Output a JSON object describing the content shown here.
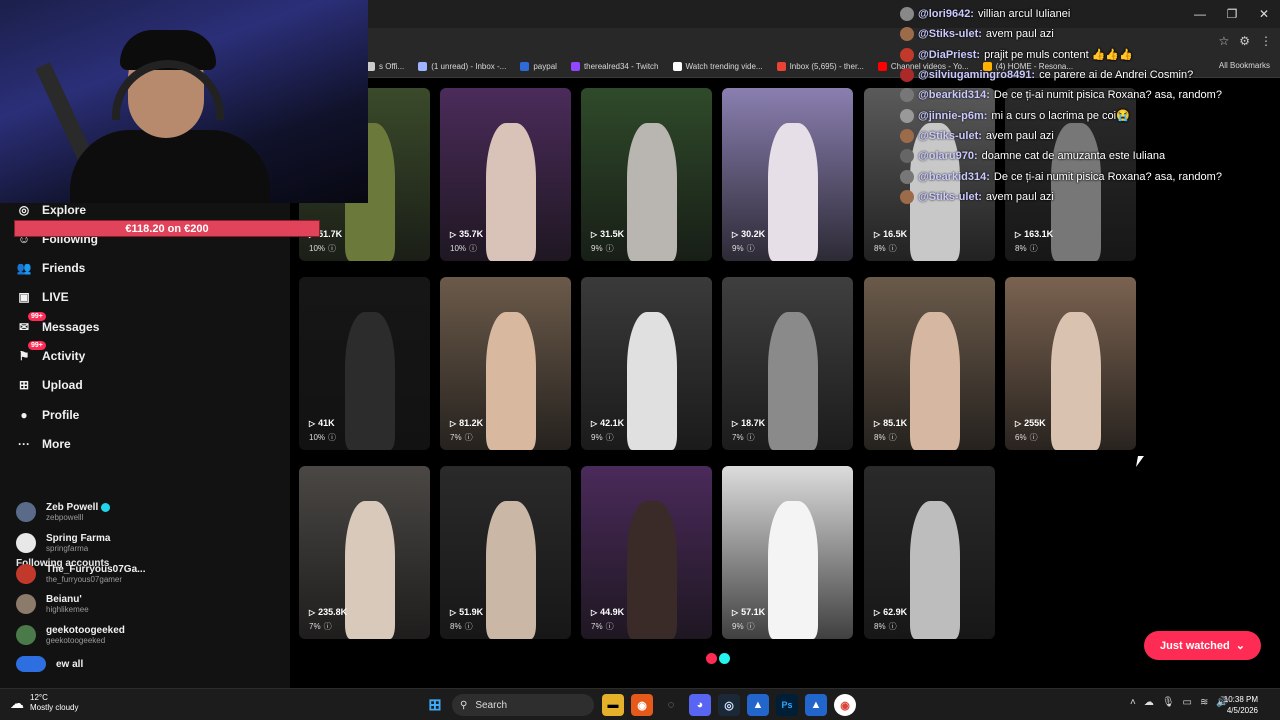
{
  "browser": {
    "bookmarks": [
      {
        "label": "s Offi...",
        "color": "#cccccc"
      },
      {
        "label": "(1 unread) - Inbox -...",
        "color": "#9fb4ff"
      },
      {
        "label": "paypal",
        "color": "#2f6bd8"
      },
      {
        "label": "therealred34 - Twitch",
        "color": "#9146ff"
      },
      {
        "label": "Watch trending vide...",
        "color": "#ffffff"
      },
      {
        "label": "Inbox (5,695) - ther...",
        "color": "#ea4335"
      },
      {
        "label": "Channel videos - Yo...",
        "color": "#ff0000"
      },
      {
        "label": "(4) HOME - Resona...",
        "color": "#ffb300"
      }
    ],
    "all_bookmarks": "All Bookmarks",
    "window_controls": [
      "—",
      "❐",
      "✕"
    ]
  },
  "overlay": {
    "donation": "€118.20 on €200"
  },
  "sidebar": {
    "nav": [
      {
        "label": "Explore",
        "icon": "compass-icon",
        "glyph": "◎",
        "badge": ""
      },
      {
        "label": "Following",
        "icon": "following-icon",
        "glyph": "☺",
        "badge": ""
      },
      {
        "label": "Friends",
        "icon": "friends-icon",
        "glyph": "👥",
        "badge": ""
      },
      {
        "label": "LIVE",
        "icon": "live-icon",
        "glyph": "▣",
        "badge": ""
      },
      {
        "label": "Messages",
        "icon": "messages-icon",
        "glyph": "✉",
        "badge": "99+"
      },
      {
        "label": "Activity",
        "icon": "activity-icon",
        "glyph": "⚑",
        "badge": "99+"
      },
      {
        "label": "Upload",
        "icon": "upload-icon",
        "glyph": "⊞",
        "badge": ""
      },
      {
        "label": "Profile",
        "icon": "profile-icon",
        "glyph": "●",
        "badge": ""
      },
      {
        "label": "More",
        "icon": "more-icon",
        "glyph": "···",
        "badge": ""
      }
    ],
    "following_accounts_title": "Following accounts",
    "accounts": [
      {
        "name": "Zeb Powell",
        "handle": "zebpowelll",
        "verified": true,
        "color": "#5a6b8a"
      },
      {
        "name": "Spring Farma",
        "handle": "springfarma",
        "verified": false,
        "color": "#e8e8e8"
      },
      {
        "name": "The_Furryous07Ga...",
        "handle": "the_furryous07gamer",
        "verified": false,
        "color": "#c0392b"
      },
      {
        "name": "Beianu'",
        "handle": "highlikemee",
        "verified": false,
        "color": "#8c7b6a"
      },
      {
        "name": "geekotoogeeked",
        "handle": "geekotoogeeked",
        "verified": false,
        "color": "#4a7a4a"
      }
    ],
    "see_all": "ew all"
  },
  "videos": [
    {
      "views": "51.7K",
      "pct": "10%",
      "bg": "#3a4a2a",
      "fig": "#6b7a3a"
    },
    {
      "views": "35.7K",
      "pct": "10%",
      "bg": "#4b2b5a",
      "fig": "#d9c3b8"
    },
    {
      "views": "31.5K",
      "pct": "9%",
      "bg": "#2f4a2a",
      "fig": "#b9b6b2"
    },
    {
      "views": "30.2K",
      "pct": "9%",
      "bg": "#8a7fb0",
      "fig": "#e6dfe8"
    },
    {
      "views": "16.5K",
      "pct": "8%",
      "bg": "#5a5a5a",
      "fig": "#c8c8c8"
    },
    {
      "views": "163.1K",
      "pct": "8%",
      "bg": "#2b2b2b",
      "fig": "#777777"
    },
    {
      "views": "41K",
      "pct": "10%",
      "bg": "#161616",
      "fig": "#2c2c2c"
    },
    {
      "views": "81.2K",
      "pct": "7%",
      "bg": "#6b5a4a",
      "fig": "#d8b9a0"
    },
    {
      "views": "42.1K",
      "pct": "9%",
      "bg": "#3a3a3a",
      "fig": "#e0e0e0"
    },
    {
      "views": "18.7K",
      "pct": "7%",
      "bg": "#3f3f3f",
      "fig": "#8a8a8a"
    },
    {
      "views": "85.1K",
      "pct": "8%",
      "bg": "#6a5a4a",
      "fig": "#d6b8a2"
    },
    {
      "views": "255K",
      "pct": "6%",
      "bg": "#7a6250",
      "fig": "#d9c2b0"
    },
    {
      "views": "235.8K",
      "pct": "7%",
      "bg": "#4a4744",
      "fig": "#d9c9bb"
    },
    {
      "views": "51.9K",
      "pct": "8%",
      "bg": "#2a2a2a",
      "fig": "#cbb7a6"
    },
    {
      "views": "44.9K",
      "pct": "7%",
      "bg": "#4a2a5a",
      "fig": "#3a2a28"
    },
    {
      "views": "57.1K",
      "pct": "9%",
      "bg": "#dcdcdc",
      "fig": "#f4f4f4"
    },
    {
      "views": "62.9K",
      "pct": "8%",
      "bg": "#2a2a2a",
      "fig": "#bdbdbd"
    }
  ],
  "chat": [
    {
      "user": "@lori9642:",
      "msg": "villian arcul Iulianei",
      "avatar": "#888888"
    },
    {
      "user": "@Stiks-ulet:",
      "msg": "avem paul azi",
      "avatar": "#9b6b4a"
    },
    {
      "user": "@DiaPriest:",
      "msg": "prajit pe muls content 👍👍👍",
      "avatar": "#c0392b"
    },
    {
      "user": "@silviugamingro8491:",
      "msg": "ce parere ai de Andrei Cosmin?",
      "avatar": "#aa2a2a"
    },
    {
      "user": "@bearkid314:",
      "msg": "De ce ți-ai numit pisica Roxana? asa, random?",
      "avatar": "#777777"
    },
    {
      "user": "@jinnie-p6m:",
      "msg": "mi a curs o lacrima pe coi😭",
      "avatar": "#999999"
    },
    {
      "user": "@Stiks-ulet:",
      "msg": "avem paul azi",
      "avatar": "#9b6b4a"
    },
    {
      "user": "@olaru970:",
      "msg": "doamne cat de amuzanta este Iuliana",
      "avatar": "#666666"
    },
    {
      "user": "@bearkid314:",
      "msg": "De ce ți-ai numit pisica Roxana? asa, random?",
      "avatar": "#777777"
    },
    {
      "user": "@Stiks-ulet:",
      "msg": "avem paul azi",
      "avatar": "#9b6b4a"
    }
  ],
  "just_watched": "Just watched",
  "taskbar": {
    "temp": "12°C",
    "weather": "Mostly cloudy",
    "search": "Search",
    "time": "10:38 PM",
    "date": "4/5/2026"
  }
}
